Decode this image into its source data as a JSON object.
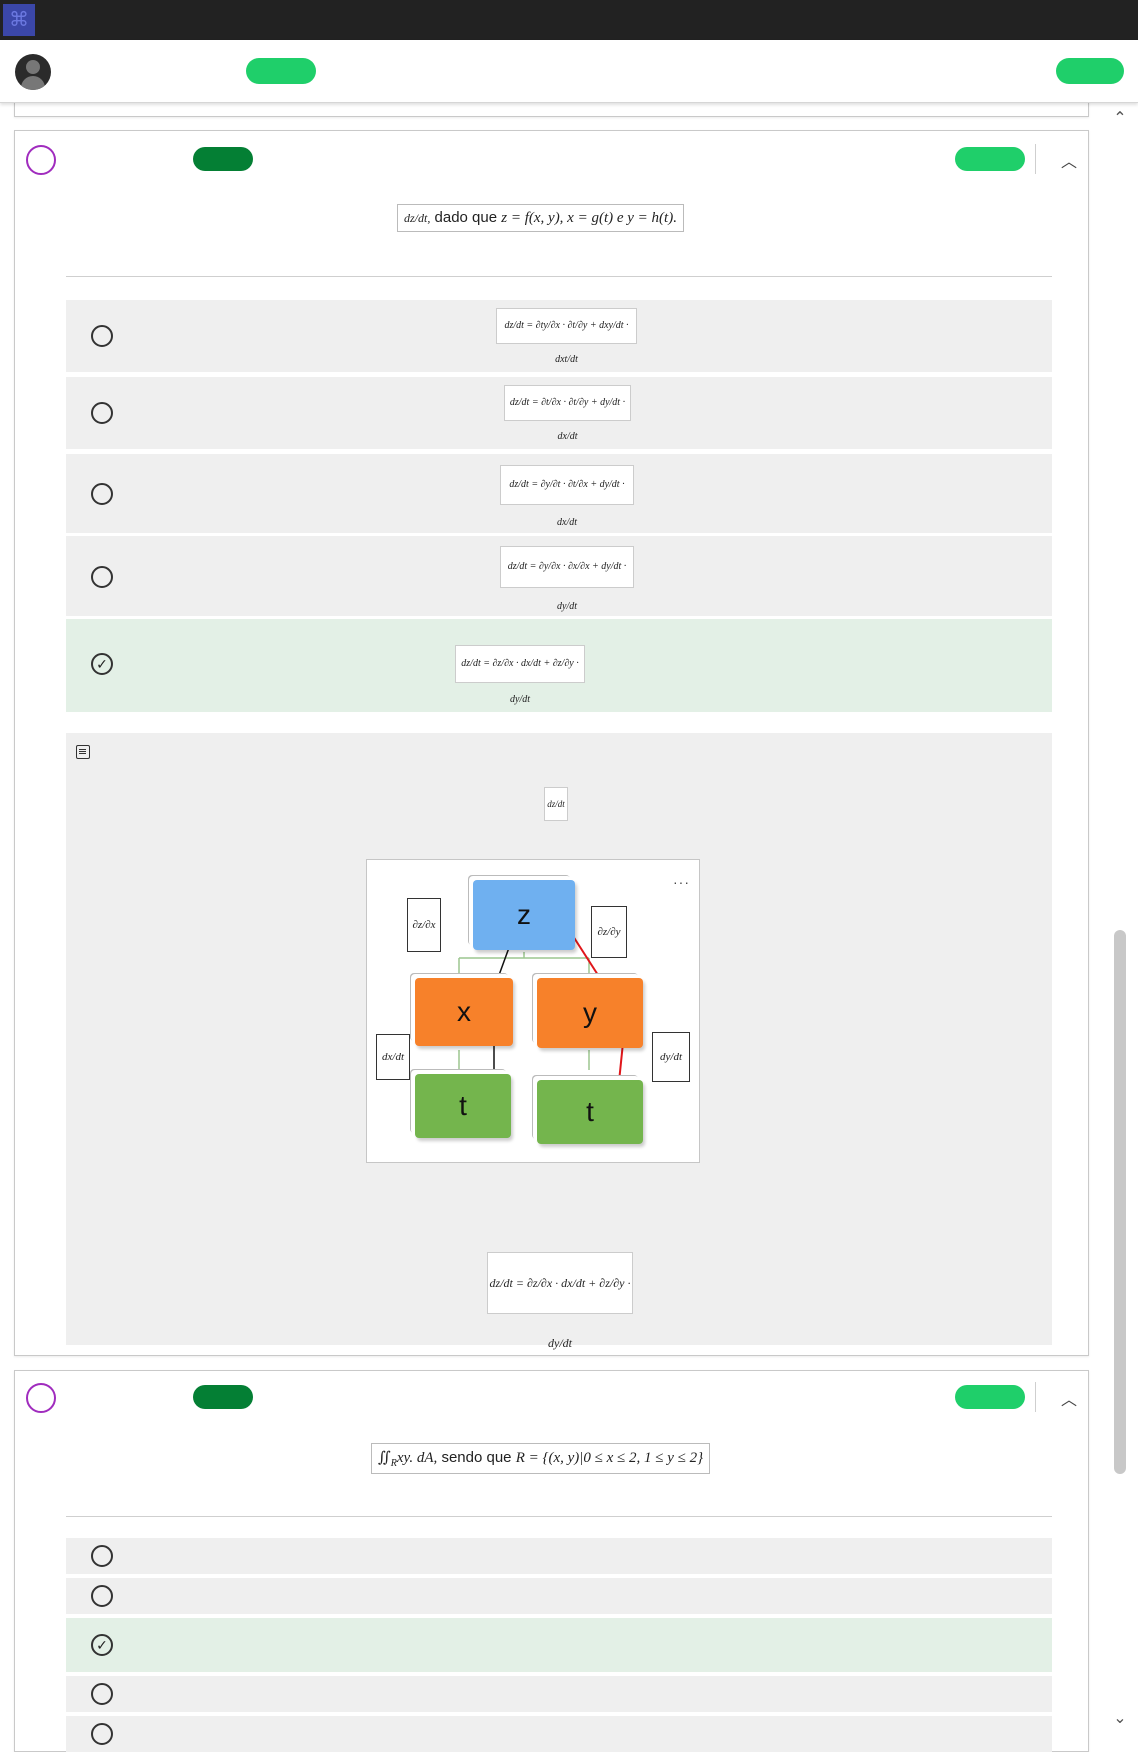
{
  "topbar": {
    "logo_icon": "app-logo-icon"
  },
  "header": {
    "avatar_icon": "user-avatar-icon"
  },
  "colors": {
    "accent_green": "#1fcf6a",
    "dark_green": "#047f34",
    "question_circle": "#a02cbe",
    "correct_bg": "#e3f0e6",
    "option_bg": "#efefef"
  },
  "question1": {
    "statement_prefix": "dz/dt,",
    "statement_text": " dado que ",
    "statement_math": "z = f(x, y), x = g(t) e y = h(t).",
    "options": [
      {
        "formula": "dz/dt = ∂ty/∂x · ∂t/∂y + dxy/dt · dxt/dt",
        "correct": false
      },
      {
        "formula": "dz/dt = ∂t/∂x · ∂t/∂y + dy/dt · dx/dt",
        "correct": false
      },
      {
        "formula": "dz/dt = ∂y/∂t · ∂t/∂x + dy/dt · dx/dt",
        "correct": false
      },
      {
        "formula": "dz/dt = ∂y/∂x · ∂x/∂x + dy/dt · dy/dt",
        "correct": false
      },
      {
        "formula": "dz/dt = ∂z/∂x · dx/dt + ∂z/∂y · dy/dt",
        "correct": true
      }
    ],
    "explanation": {
      "note_icon": "note-icon",
      "small_formula": "dz/dt",
      "tree": {
        "nodes": [
          "z",
          "x",
          "y",
          "t",
          "t"
        ],
        "partials": [
          "∂z/∂x",
          "∂z/∂y",
          "dx/dt",
          "dy/dt"
        ],
        "more_icon": "more-options-icon"
      },
      "final_formula": "dz/dt = ∂z/∂x · dx/dt + ∂z/∂y · dy/dt"
    }
  },
  "question2": {
    "statement_integral": "∬",
    "statement_sub": "R",
    "statement_math": "xy. dA,",
    "statement_text": " sendo que ",
    "statement_region": "R = {(x, y)|0 ≤ x ≤ 2, 1 ≤ y ≤ 2}",
    "options": [
      {
        "correct": false
      },
      {
        "correct": false
      },
      {
        "correct": true
      },
      {
        "correct": false
      },
      {
        "correct": false
      }
    ]
  }
}
